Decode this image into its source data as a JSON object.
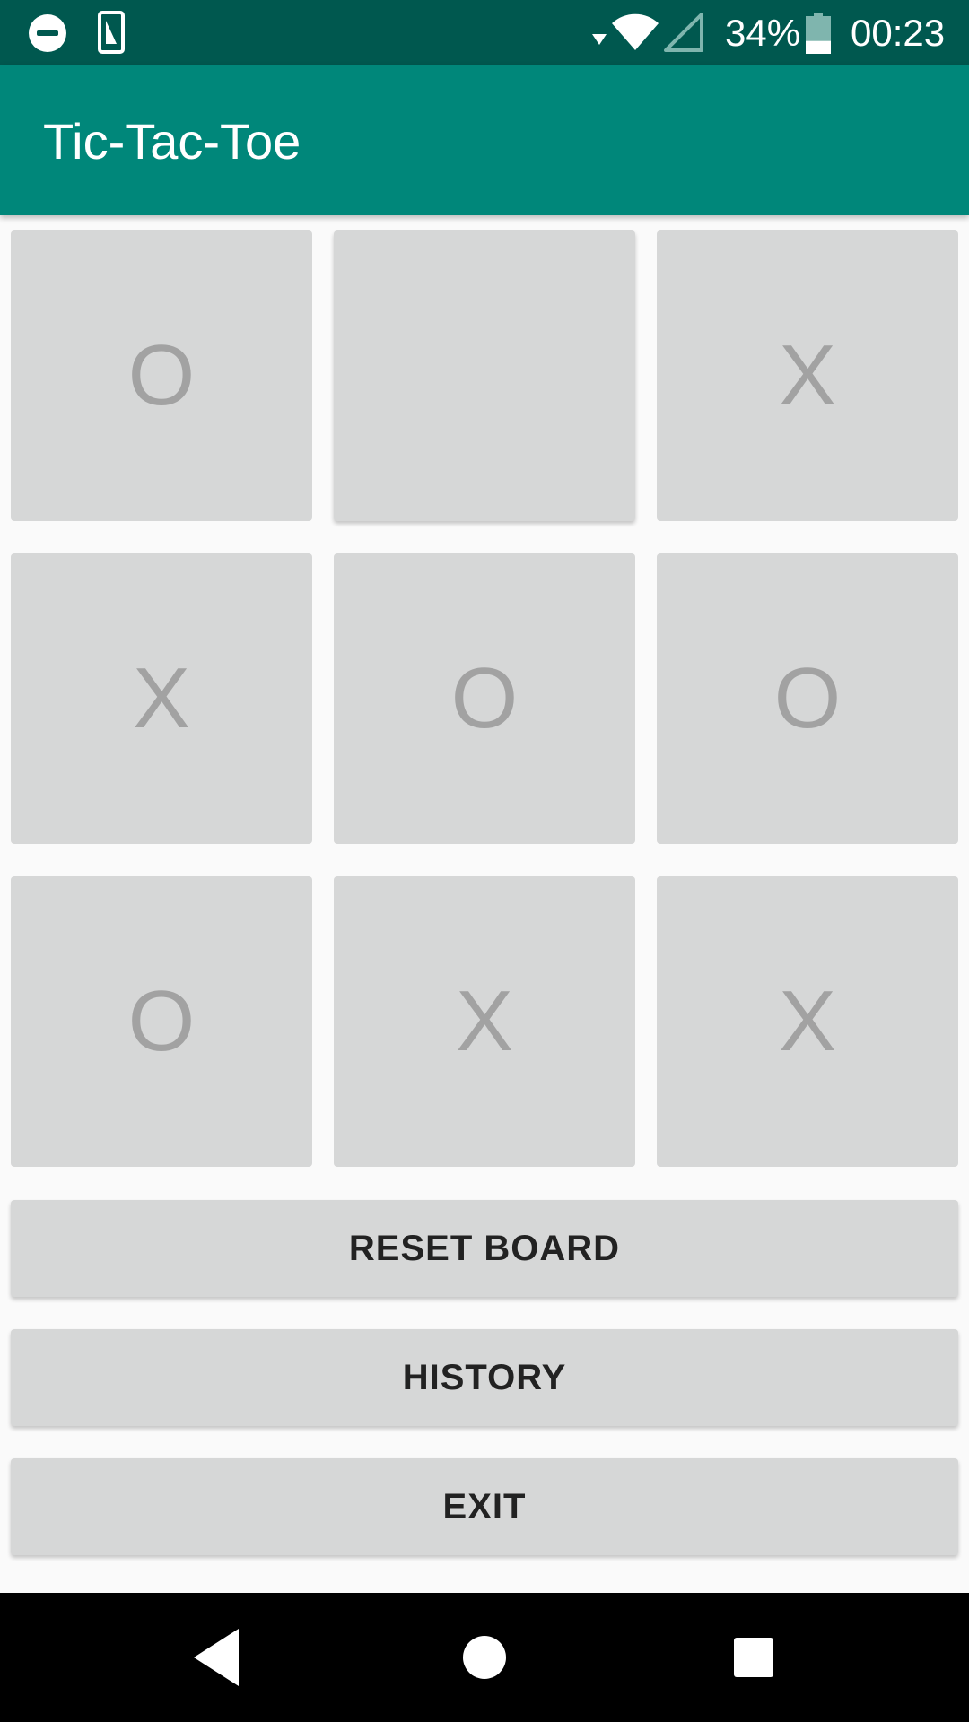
{
  "status_bar": {
    "battery_percent": "34%",
    "time": "00:23",
    "battery_level": 0.34
  },
  "app_bar": {
    "title": "Tic-Tac-Toe"
  },
  "board": {
    "cells": [
      "O",
      "",
      "X",
      "X",
      "O",
      "O",
      "O",
      "X",
      "X"
    ]
  },
  "buttons": {
    "reset_label": "RESET BOARD",
    "history_label": "HISTORY",
    "exit_label": "EXIT"
  },
  "nav_bar": {
    "back": "back-icon",
    "home": "home-icon",
    "recents": "recents-icon"
  },
  "colors": {
    "status_bar": "#00584f",
    "app_bar": "#00877a",
    "cell_bg": "#d6d7d7",
    "cell_text": "#a2a2a2"
  }
}
